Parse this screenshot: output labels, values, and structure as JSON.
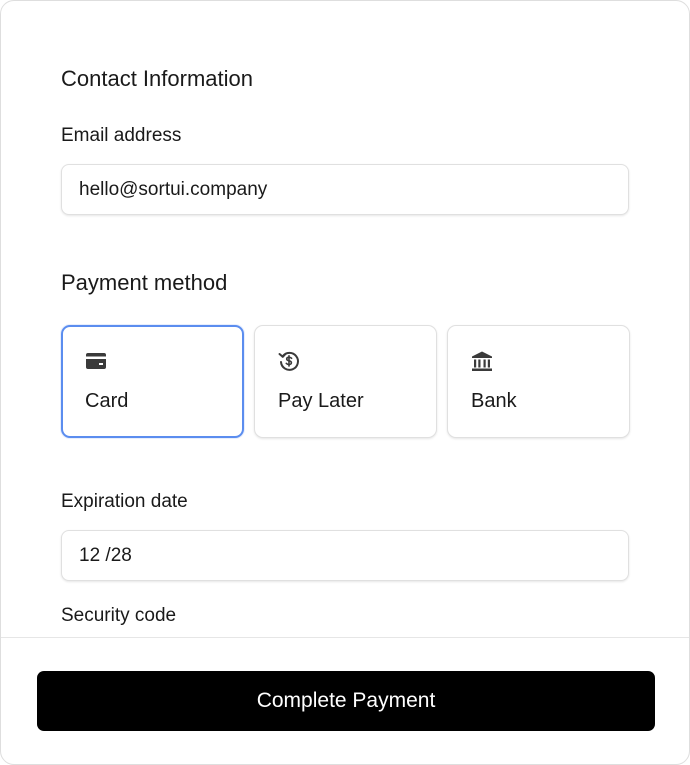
{
  "contact": {
    "title": "Contact Information",
    "email_label": "Email address",
    "email_value": "hello@sortui.company"
  },
  "payment": {
    "title": "Payment method",
    "selected": "Card",
    "methods": [
      {
        "label": "Card",
        "icon": "credit-card-icon"
      },
      {
        "label": "Pay Later",
        "icon": "dollar-cycle-icon"
      },
      {
        "label": "Bank",
        "icon": "bank-icon"
      }
    ]
  },
  "expiration": {
    "label": "Expiration date",
    "value": "12 /28"
  },
  "security": {
    "label": "Security code"
  },
  "footer": {
    "submit_label": "Complete Payment"
  },
  "colors": {
    "accent": "#5b8def",
    "button_bg": "#000000",
    "button_text": "#ffffff"
  }
}
